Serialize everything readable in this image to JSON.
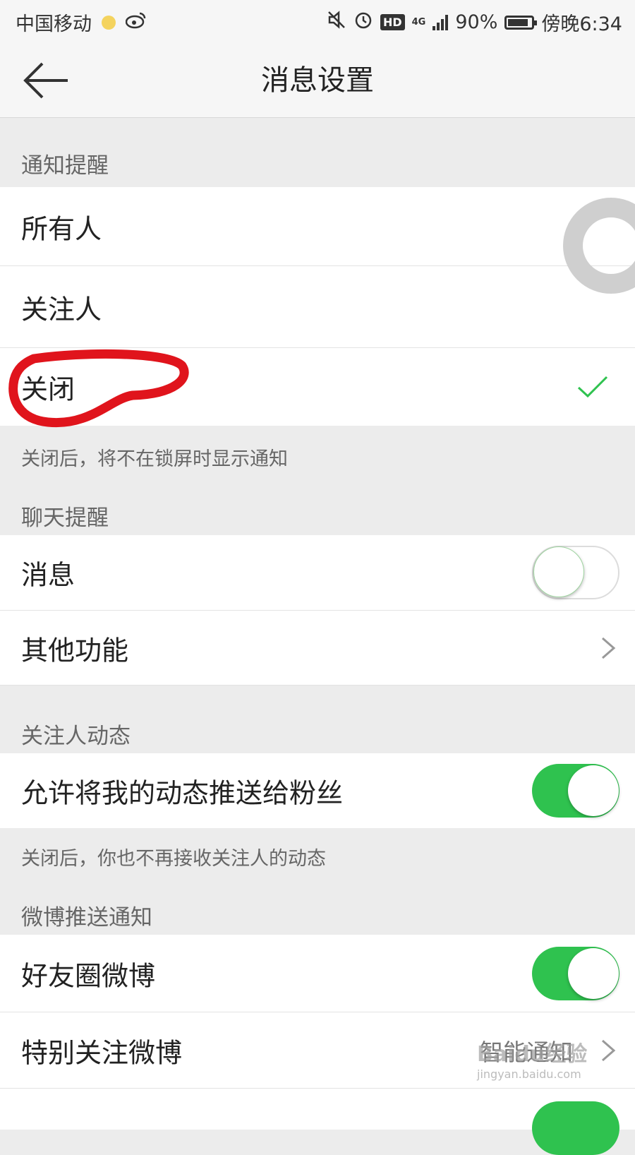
{
  "status_bar": {
    "carrier": "中国移动",
    "hd": "HD",
    "network": "4G",
    "battery": "90%",
    "time": "傍晚6:34"
  },
  "nav": {
    "title": "消息设置"
  },
  "sections": {
    "notify": {
      "title": "通知提醒",
      "options": [
        "所有人",
        "关注人",
        "关闭"
      ],
      "selected": "关闭",
      "note": "关闭后，将不在锁屏时显示通知"
    },
    "chat": {
      "title": "聊天提醒",
      "message_label": "消息",
      "message_on": false,
      "other_label": "其他功能"
    },
    "following": {
      "title": "关注人动态",
      "push_label": "允许将我的动态推送给粉丝",
      "push_on": true,
      "note": "关闭后，你也不再接收关注人的动态"
    },
    "weibo_push": {
      "title": "微博推送通知",
      "friends_label": "好友圈微博",
      "friends_on": true,
      "special_label": "特别关注微博",
      "special_value": "智能通知"
    }
  },
  "watermark": {
    "text": "Baidu经验",
    "url": "jingyan.baidu.com"
  },
  "colors": {
    "toggle_on": "#2fc24f",
    "check": "#2fc24f",
    "annotation": "#e0141c"
  }
}
